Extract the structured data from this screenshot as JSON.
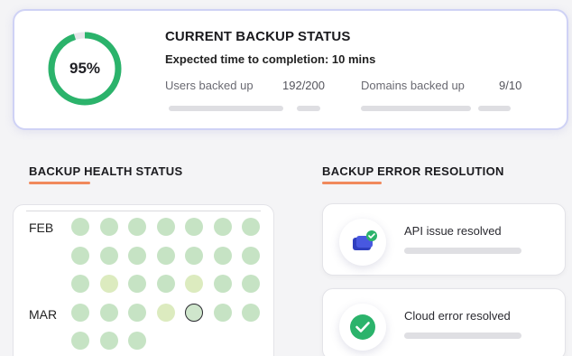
{
  "backup_status": {
    "title": "CURRENT BACKUP STATUS",
    "percent_label": "95%",
    "progress": 0.95,
    "expected_completion": "Expected time to completion: 10 mins",
    "users_label": "Users backed up",
    "users_value": "192/200",
    "domains_label": "Domains backed up",
    "domains_value": "9/10"
  },
  "health": {
    "title": "BACKUP HEALTH STATUS",
    "months": [
      "FEB",
      "MAR"
    ],
    "rows": [
      [
        "ok",
        "ok",
        "ok",
        "ok",
        "ok",
        "ok",
        "ok"
      ],
      [
        "ok",
        "ok",
        "ok",
        "ok",
        "ok",
        "ok",
        "ok"
      ],
      [
        "ok",
        "warn",
        "ok",
        "ok",
        "warn",
        "ok",
        "ok"
      ],
      [
        "ok",
        "ok",
        "ok",
        "warn",
        "selected",
        "ok",
        "ok"
      ],
      [
        "ok",
        "ok",
        "ok"
      ]
    ],
    "colors": {
      "ok": "#c6e3c4",
      "warn": "#dcebbf",
      "selected": "#cfe6cc",
      "accent": "#f0895c",
      "ring": "#2bb36b"
    }
  },
  "resolution": {
    "title": "BACKUP ERROR RESOLUTION",
    "items": [
      {
        "label": "API issue resolved",
        "icon": "api-window-check-icon"
      },
      {
        "label": "Cloud error resolved",
        "icon": "check-circle-icon"
      }
    ]
  }
}
